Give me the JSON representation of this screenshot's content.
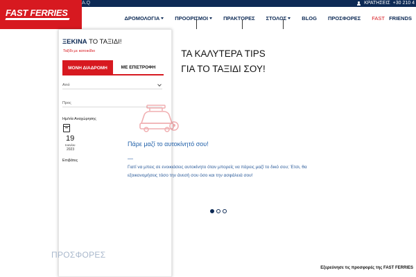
{
  "topbar": {
    "left_text": "A.Q",
    "bookings_label": "ΚΡΑΤΗΣΕΙΣ",
    "phone": "+30 210 4"
  },
  "logo": {
    "text": "FAST FERRIES"
  },
  "nav": {
    "items": [
      {
        "label": "ΔΡΟΜΟΛΟΓΙΑ",
        "dropdown": true
      },
      {
        "label": "ΠΡΟΟΡΙΣΜΟΙ",
        "dropdown": true
      },
      {
        "label": "ΠΡΑΚΤΟΡΕΣ",
        "dropdown": false
      },
      {
        "label": "ΣΤΟΛΟΣ",
        "dropdown": true
      },
      {
        "label": "BLOG",
        "dropdown": false
      },
      {
        "label": "ΠΡΟΣΦΟΡΕΣ",
        "dropdown": false
      },
      {
        "label_prefix": "FAST",
        "label_suffix": "FRIENDS",
        "dropdown": false
      }
    ]
  },
  "booking": {
    "title_accent": "ΞΕΚΙΝΑ",
    "title_rest": " ΤΟ ΤΑΞΙΔΙ!",
    "subtitle": "Ταξίδι με κατοικίδιο",
    "tabs": {
      "one_way": "ΜΟΝΗ ΔΙΑΔΡΟΜΗ",
      "return": "ΜΕ ΕΠΙΣΤΡΟΦΗ"
    },
    "from_placeholder": "Από",
    "to_placeholder": "Προς",
    "date_label": "Ημ/νία Αναχώρησης",
    "date_day": "19",
    "date_month": "Ιουνίου",
    "date_year": "2023",
    "passengers_label": "Επιβάτες"
  },
  "hero": {
    "title_line1": "ΤΑ ΚΑΛΥΤΕΡΑ TIPS",
    "title_line2": "ΓΙΑ ΤΟ ΤΑΞΙΔΙ ΣΟΥ!",
    "tip_heading": "Πάρε μαζί το αυτοκίνητό σου!",
    "tip_body": "Γιατί να μπεις σε ενοικιάσεις αυτοκίνητο όταν μπορείς να πάρεις μαζί το δικό σου; Έτσι, θα εξοικονομήσεις τόσο την άνεσή σου όσο και την ασφάλειά σου!",
    "slides_total": 3,
    "slide_active": 1
  },
  "offers": {
    "title": "ΠΡΟΣΦΟΡΕΣ",
    "link": "Εξερεύνησε τις προσφορές της FAST FERRIES"
  },
  "colors": {
    "brand_red": "#d71920",
    "navy": "#0d2a55",
    "tip_blue": "#1f5fa8"
  }
}
